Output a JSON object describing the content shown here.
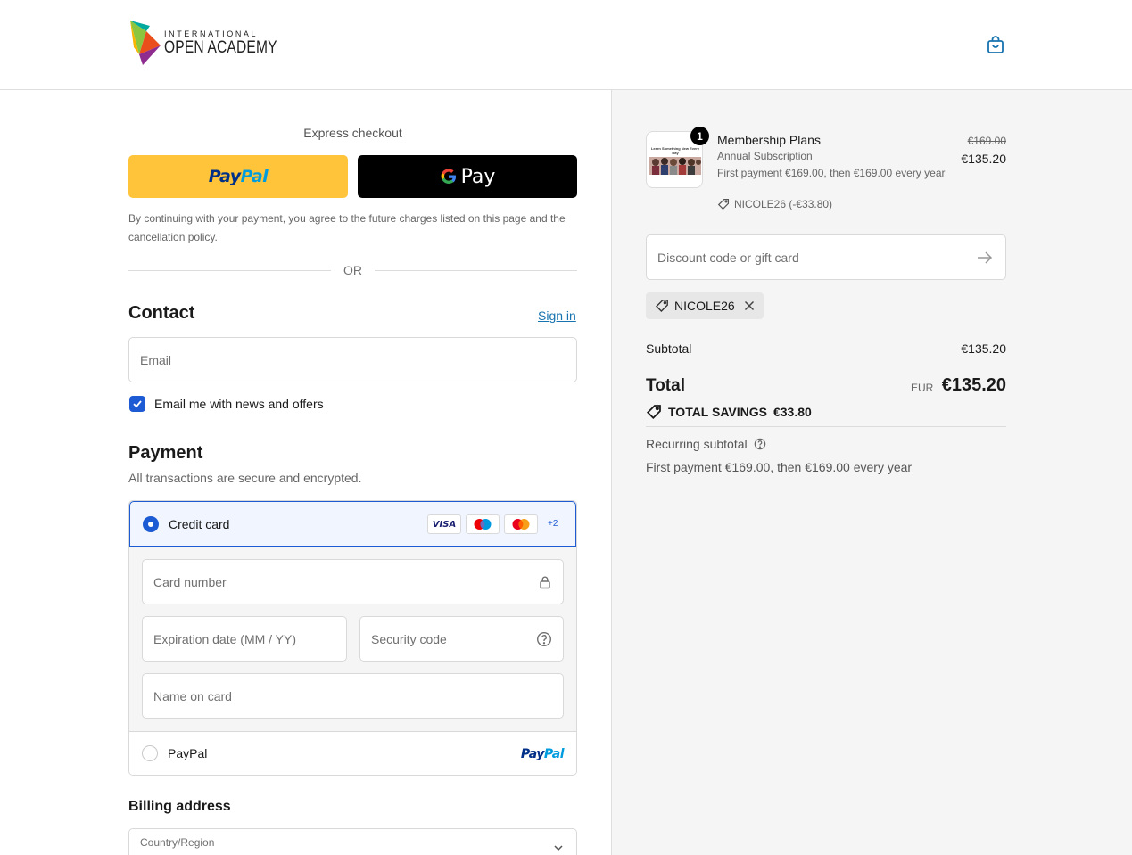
{
  "header": {
    "logo_top": "INTERNATIONAL",
    "logo_bottom": "OPEN ACADEMY",
    "cart_icon": "shopping-bag-icon"
  },
  "express": {
    "title": "Express checkout",
    "paypal_label_a": "Pay",
    "paypal_label_b": "Pal",
    "gpay_label": "Pay",
    "disclaimer": "By continuing with your payment, you agree to the future charges listed on this page and the cancellation policy.",
    "or": "OR"
  },
  "contact": {
    "title": "Contact",
    "sign_in": "Sign in",
    "email_placeholder": "Email",
    "newsletter_label": "Email me with news and offers",
    "newsletter_checked": true
  },
  "payment": {
    "title": "Payment",
    "subtitle": "All transactions are secure and encrypted.",
    "credit_card_label": "Credit card",
    "card_brands": [
      "VISA",
      "maestro",
      "mastercard"
    ],
    "more_brands": "+2",
    "card_number_placeholder": "Card number",
    "expiry_placeholder": "Expiration date (MM / YY)",
    "security_placeholder": "Security code",
    "name_placeholder": "Name on card",
    "paypal_label": "PayPal",
    "paypal_logo_a": "Pay",
    "paypal_logo_b": "Pal"
  },
  "billing": {
    "title": "Billing address",
    "country_label": "Country/Region"
  },
  "order": {
    "quantity": "1",
    "product_title": "Membership Plans",
    "product_subtitle": "Annual Subscription",
    "product_description": "First payment €169.00, then €169.00 every year",
    "product_discount": "NICOLE26 (-€33.80)",
    "thumb_text": "Learn Something New Every Day",
    "price_original": "€169.00",
    "price_current": "€135.20",
    "discount_placeholder": "Discount code or gift card",
    "applied_code": "NICOLE26",
    "subtotal_label": "Subtotal",
    "subtotal_value": "€135.20",
    "total_label": "Total",
    "total_currency": "EUR",
    "total_value": "€135.20",
    "savings_label": "TOTAL SAVINGS",
    "savings_value": "€33.80",
    "recurring_label": "Recurring subtotal",
    "recurring_text": "First payment €169.00, then €169.00 every year"
  },
  "colors": {
    "accent": "#1c5bd3",
    "link": "#1773b0",
    "paypal_yellow": "#ffc439",
    "panel_bg": "#f5f5f5"
  }
}
